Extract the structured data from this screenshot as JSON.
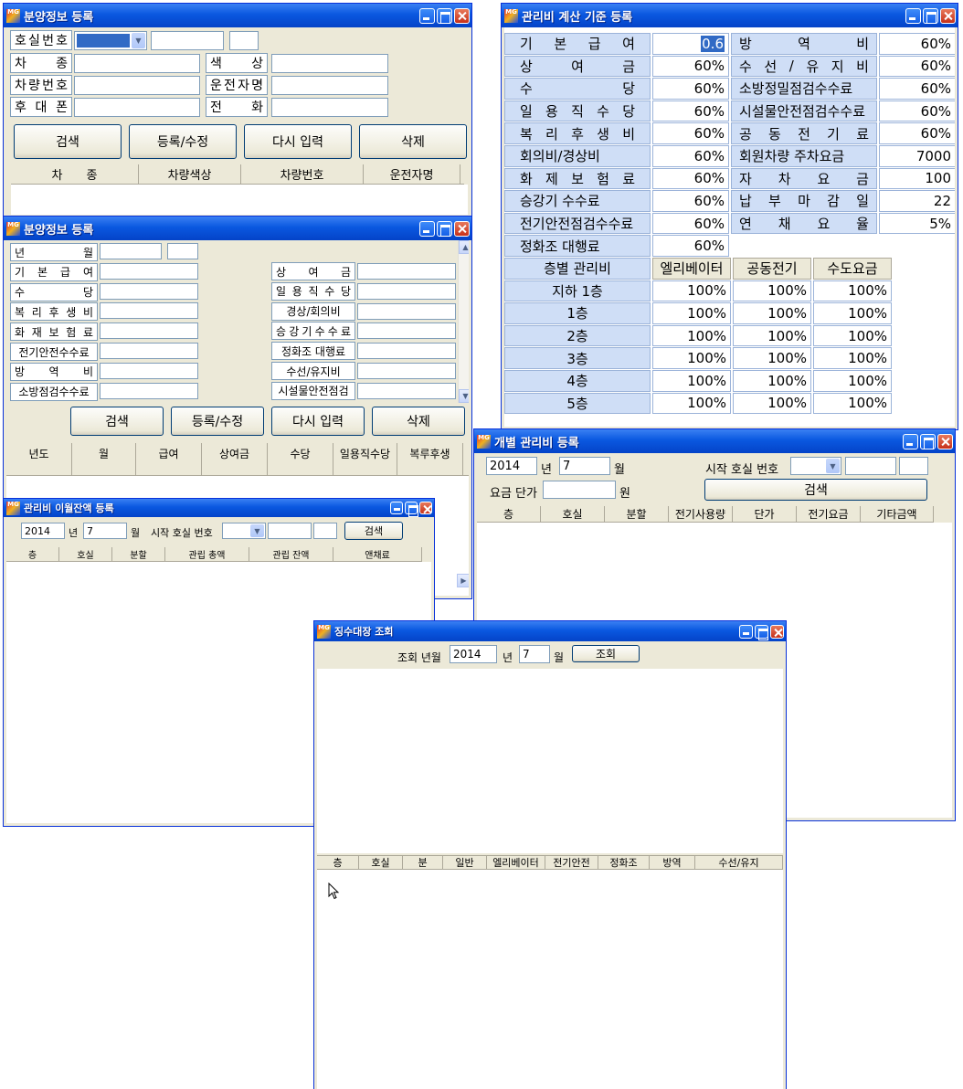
{
  "w1": {
    "title": "분양정보 등록",
    "labels": [
      [
        "호",
        "실",
        "번",
        "호"
      ],
      [
        "차",
        "종"
      ],
      [
        "차",
        "량",
        "번",
        "호"
      ],
      [
        "후",
        "대",
        "폰"
      ],
      [
        "색",
        "상"
      ],
      [
        "운",
        "전",
        "자",
        "명"
      ],
      [
        "전",
        "화"
      ]
    ],
    "buttons": [
      "검색",
      "등록/수정",
      "다시 입력",
      "삭제"
    ],
    "headers": [
      "차　　종",
      "차량색상",
      "차량번호",
      "운전자명"
    ]
  },
  "w2": {
    "title": "분양정보 등록",
    "left_labels": [
      [
        "년",
        "월"
      ],
      [
        "기",
        "본",
        "급",
        "여"
      ],
      [
        "수",
        "당"
      ],
      [
        "복",
        "리",
        "후",
        "생",
        "비"
      ],
      [
        "화",
        "재",
        "보",
        "험",
        "료"
      ],
      [
        "전기안전수수료"
      ],
      [
        "방",
        "역",
        "비"
      ],
      [
        "소방점검수수료"
      ]
    ],
    "right_labels": [
      [
        "상",
        "여",
        "금"
      ],
      [
        "일",
        "용",
        "직",
        "수",
        "당"
      ],
      [
        "경상/회의비"
      ],
      [
        "승",
        "강",
        "기",
        "수",
        "수",
        "료"
      ],
      [
        "정화조 대행료"
      ],
      [
        "수선/유지비"
      ],
      [
        "시설물안전점검"
      ]
    ],
    "buttons": [
      "검색",
      "등록/수정",
      "다시 입력",
      "삭제"
    ],
    "headers": [
      "년도",
      "월",
      "급여",
      "상여금",
      "수당",
      "일용직수당",
      "복루후생"
    ]
  },
  "w3": {
    "title": "관리비 계산 기준 등록",
    "rows": [
      {
        "l1": [
          "기",
          "본",
          "급",
          "여"
        ],
        "v1": "0.6",
        "l2": [
          "방",
          "역",
          "비"
        ],
        "v2": "60%"
      },
      {
        "l1": [
          "상",
          "여",
          "금"
        ],
        "v1": "60%",
        "l2": [
          "수",
          "선",
          "/",
          "유",
          "지",
          "비"
        ],
        "v2": "60%"
      },
      {
        "l1": [
          "수",
          "당"
        ],
        "v1": "60%",
        "l2": [
          "소방정밀점검수수료"
        ],
        "v2": "60%"
      },
      {
        "l1": [
          "일",
          "용",
          "직",
          "수",
          "당"
        ],
        "v1": "60%",
        "l2": [
          "시설물안전점검수수료"
        ],
        "v2": "60%"
      },
      {
        "l1": [
          "복",
          "리",
          "후",
          "생",
          "비"
        ],
        "v1": "60%",
        "l2": [
          "공",
          "동",
          "전",
          "기",
          "료"
        ],
        "v2": "60%"
      },
      {
        "l1": [
          "회의비/경상비"
        ],
        "v1": "60%",
        "l2": [
          "회원차량 주차요금"
        ],
        "v2": "7000"
      },
      {
        "l1": [
          "화",
          "제",
          "보",
          "험",
          "료"
        ],
        "v1": "60%",
        "l2": [
          "자",
          "차",
          "요",
          "금"
        ],
        "v2": "100"
      },
      {
        "l1": [
          "승강기 수수료"
        ],
        "v1": "60%",
        "l2": [
          "납",
          "부",
          "마",
          "감",
          "일"
        ],
        "v2": "22"
      },
      {
        "l1": [
          "전기안전점검수수료"
        ],
        "v1": "60%",
        "l2": [
          "연",
          "채",
          "요",
          "율"
        ],
        "v2": "5%"
      },
      {
        "l1": [
          "정화조 대행료"
        ],
        "v1": "60%"
      }
    ],
    "floor_header": [
      "층별 관리비",
      "엘리베이터",
      "공동전기",
      "수도요금"
    ],
    "floors": [
      {
        "name": "지하 1층",
        "v": [
          "100%",
          "100%",
          "100%"
        ]
      },
      {
        "name": "1층",
        "v": [
          "100%",
          "100%",
          "100%"
        ]
      },
      {
        "name": "2층",
        "v": [
          "100%",
          "100%",
          "100%"
        ]
      },
      {
        "name": "3층",
        "v": [
          "100%",
          "100%",
          "100%"
        ]
      },
      {
        "name": "4층",
        "v": [
          "100%",
          "100%",
          "100%"
        ]
      },
      {
        "name": "5층",
        "v": [
          "100%",
          "100%",
          "100%"
        ]
      }
    ]
  },
  "w4": {
    "title": "관리비 이월잔액 등록",
    "year": "2014",
    "year_suffix": "년",
    "month": "7",
    "month_suffix": "월",
    "room_label": "시작 호실 번호",
    "search": "검색",
    "headers": [
      "층",
      "호실",
      "분할",
      "관립 총액",
      "관립 잔액",
      "앤채료"
    ]
  },
  "w5": {
    "title": "개별 관리비 등록",
    "year": "2014",
    "year_suffix": "년",
    "month": "7",
    "month_suffix": "월",
    "room_label": "시작 호실 번호",
    "price_label": "요금 단가",
    "price_suffix": "원",
    "search": "검색",
    "headers": [
      "층",
      "호실",
      "분할",
      "전기사용량",
      "단가",
      "전기요금",
      "기타금액"
    ]
  },
  "w6": {
    "title": "징수대장 조회",
    "query_label": "조회 년월",
    "year": "2014",
    "year_suffix": "년",
    "month": "7",
    "month_suffix": "월",
    "button": "조회",
    "headers": [
      "층",
      "호실",
      "분",
      "일반",
      "엘리베이터",
      "전기안전",
      "정화조",
      "방역",
      "수선/유지"
    ]
  },
  "icons": {
    "logo": "MG"
  },
  "colors": {
    "titlebar": "#0a58e0",
    "grid_label": "#cfdef6",
    "window_face": "#ece9d8"
  }
}
